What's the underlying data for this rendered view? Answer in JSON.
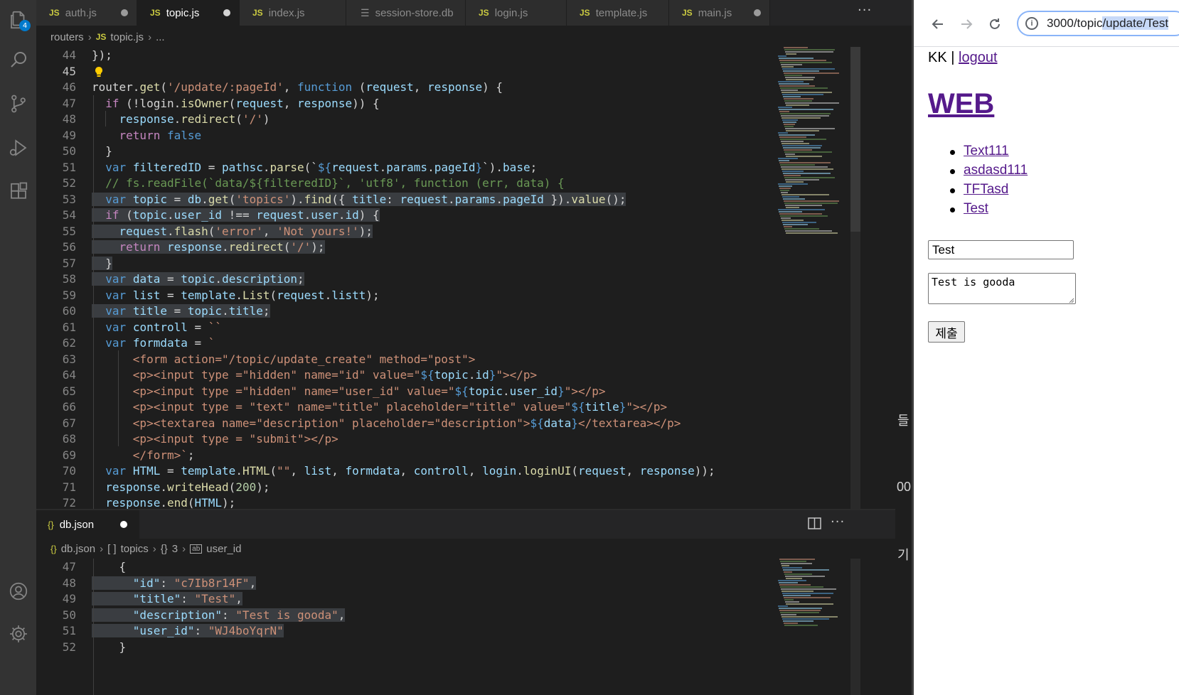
{
  "colors": {
    "accent": "#007acc",
    "editor_bg": "#1e1e1e",
    "selection": "#264f78",
    "link_visited": "#551a8b"
  },
  "vscode": {
    "explorer_badge": "4",
    "tabs": [
      {
        "label": "auth.js",
        "icon": "js-icon",
        "dirty": true
      },
      {
        "label": "topic.js",
        "icon": "js-icon",
        "dirty": true,
        "active": true
      },
      {
        "label": "index.js",
        "icon": "js-icon",
        "dirty": false
      },
      {
        "label": "session-store.db",
        "icon": "file-lines-icon",
        "dirty": false
      },
      {
        "label": "login.js",
        "icon": "js-icon",
        "dirty": false
      },
      {
        "label": "template.js",
        "icon": "js-icon",
        "dirty": false
      },
      {
        "label": "main.js",
        "icon": "js-icon",
        "dirty": true
      }
    ],
    "more_actions": "···",
    "breadcrumb": {
      "folder": "routers",
      "file": "topic.js",
      "tail": "..."
    },
    "editor_lines": [
      {
        "n": "44",
        "tokens": [
          [
            "p",
            "});"
          ]
        ]
      },
      {
        "n": "45",
        "tokens": [
          [
            "p",
            ""
          ]
        ],
        "lightbulb": true
      },
      {
        "n": "46",
        "tokens": [
          [
            "p",
            "router."
          ],
          [
            "f",
            "get"
          ],
          [
            "p",
            "("
          ],
          [
            "s",
            "'/update/:pageId'"
          ],
          [
            "p",
            ", "
          ],
          [
            "k",
            "function"
          ],
          [
            "p",
            " ("
          ],
          [
            "v",
            "request"
          ],
          [
            "p",
            ", "
          ],
          [
            "v",
            "response"
          ],
          [
            "p",
            ") {"
          ]
        ]
      },
      {
        "n": "47",
        "tokens": [
          [
            "p",
            "  "
          ],
          [
            "cf",
            "if"
          ],
          [
            "p",
            " (!login."
          ],
          [
            "f",
            "isOwner"
          ],
          [
            "p",
            "("
          ],
          [
            "v",
            "request"
          ],
          [
            "p",
            ", "
          ],
          [
            "v",
            "response"
          ],
          [
            "p",
            ")) {"
          ]
        ]
      },
      {
        "n": "48",
        "tokens": [
          [
            "p",
            "    "
          ],
          [
            "v",
            "response"
          ],
          [
            "p",
            "."
          ],
          [
            "f",
            "redirect"
          ],
          [
            "p",
            "("
          ],
          [
            "s",
            "'/'"
          ],
          [
            "p",
            ")"
          ]
        ]
      },
      {
        "n": "49",
        "tokens": [
          [
            "p",
            "    "
          ],
          [
            "cf",
            "return"
          ],
          [
            "p",
            " "
          ],
          [
            "k",
            "false"
          ]
        ]
      },
      {
        "n": "50",
        "tokens": [
          [
            "p",
            "  }"
          ]
        ]
      },
      {
        "n": "51",
        "tokens": [
          [
            "p",
            "  "
          ],
          [
            "k",
            "var"
          ],
          [
            "p",
            " "
          ],
          [
            "v",
            "filteredID"
          ],
          [
            "p",
            " = "
          ],
          [
            "v",
            "pathsc"
          ],
          [
            "p",
            "."
          ],
          [
            "f",
            "parse"
          ],
          [
            "p",
            "(`"
          ],
          [
            "tp",
            "${"
          ],
          [
            "v",
            "request"
          ],
          [
            "p",
            "."
          ],
          [
            "v",
            "params"
          ],
          [
            "p",
            "."
          ],
          [
            "v",
            "pageId"
          ],
          [
            "tp",
            "}"
          ],
          [
            "p",
            "`)."
          ],
          [
            "v",
            "base"
          ],
          [
            "p",
            ";"
          ]
        ]
      },
      {
        "n": "52",
        "tokens": [
          [
            "p",
            "  "
          ],
          [
            "c",
            "// fs.readFile(`data/${filteredID}`, 'utf8', function (err, data) {"
          ]
        ]
      },
      {
        "n": "53",
        "hl": true,
        "tokens": [
          [
            "p",
            "  "
          ],
          [
            "k",
            "var"
          ],
          [
            "p",
            " "
          ],
          [
            "v",
            "topic"
          ],
          [
            "p",
            " = "
          ],
          [
            "v",
            "db"
          ],
          [
            "p",
            "."
          ],
          [
            "f",
            "get"
          ],
          [
            "p",
            "("
          ],
          [
            "s",
            "'topics'"
          ],
          [
            "p",
            ")."
          ],
          [
            "f",
            "find"
          ],
          [
            "p",
            "({ "
          ],
          [
            "v",
            "title"
          ],
          [
            "p",
            ": "
          ],
          [
            "v",
            "request"
          ],
          [
            "p",
            "."
          ],
          [
            "v",
            "params"
          ],
          [
            "p",
            "."
          ],
          [
            "v",
            "pageId"
          ],
          [
            "p",
            " })."
          ],
          [
            "f",
            "value"
          ],
          [
            "p",
            "();"
          ]
        ]
      },
      {
        "n": "54",
        "hl": true,
        "tokens": [
          [
            "p",
            "  "
          ],
          [
            "cf",
            "if"
          ],
          [
            "p",
            " ("
          ],
          [
            "v",
            "topic"
          ],
          [
            "p",
            "."
          ],
          [
            "v",
            "user_id"
          ],
          [
            "p",
            " !== "
          ],
          [
            "v",
            "request"
          ],
          [
            "p",
            "."
          ],
          [
            "v",
            "user"
          ],
          [
            "p",
            "."
          ],
          [
            "v",
            "id"
          ],
          [
            "p",
            ") {"
          ]
        ]
      },
      {
        "n": "55",
        "hl": true,
        "tokens": [
          [
            "p",
            "    "
          ],
          [
            "v",
            "request"
          ],
          [
            "p",
            "."
          ],
          [
            "f",
            "flash"
          ],
          [
            "p",
            "("
          ],
          [
            "s",
            "'error'"
          ],
          [
            "p",
            ", "
          ],
          [
            "s",
            "'Not yours!'"
          ],
          [
            "p",
            ");"
          ]
        ]
      },
      {
        "n": "56",
        "hl": true,
        "tokens": [
          [
            "p",
            "    "
          ],
          [
            "cf",
            "return"
          ],
          [
            "p",
            " "
          ],
          [
            "v",
            "response"
          ],
          [
            "p",
            "."
          ],
          [
            "f",
            "redirect"
          ],
          [
            "p",
            "("
          ],
          [
            "s",
            "'/'"
          ],
          [
            "p",
            ");"
          ]
        ]
      },
      {
        "n": "57",
        "hl": true,
        "tokens": [
          [
            "p",
            "  }"
          ]
        ]
      },
      {
        "n": "58",
        "hl": true,
        "tokens": [
          [
            "p",
            "  "
          ],
          [
            "k",
            "var"
          ],
          [
            "p",
            " "
          ],
          [
            "v",
            "data"
          ],
          [
            "p",
            " = "
          ],
          [
            "v",
            "topic"
          ],
          [
            "p",
            "."
          ],
          [
            "v",
            "description"
          ],
          [
            "p",
            ";"
          ]
        ]
      },
      {
        "n": "59",
        "tokens": [
          [
            "p",
            "  "
          ],
          [
            "k",
            "var"
          ],
          [
            "p",
            " "
          ],
          [
            "v",
            "list"
          ],
          [
            "p",
            " = "
          ],
          [
            "v",
            "template"
          ],
          [
            "p",
            "."
          ],
          [
            "f",
            "List"
          ],
          [
            "p",
            "("
          ],
          [
            "v",
            "request"
          ],
          [
            "p",
            "."
          ],
          [
            "v",
            "listt"
          ],
          [
            "p",
            ");"
          ]
        ]
      },
      {
        "n": "60",
        "hl": true,
        "tokens": [
          [
            "p",
            "  "
          ],
          [
            "k",
            "var"
          ],
          [
            "p",
            " "
          ],
          [
            "v",
            "title"
          ],
          [
            "p",
            " = "
          ],
          [
            "v",
            "topic"
          ],
          [
            "p",
            "."
          ],
          [
            "v",
            "title"
          ],
          [
            "p",
            ";"
          ]
        ]
      },
      {
        "n": "61",
        "tokens": [
          [
            "p",
            "  "
          ],
          [
            "k",
            "var"
          ],
          [
            "p",
            " "
          ],
          [
            "v",
            "controll"
          ],
          [
            "p",
            " = "
          ],
          [
            "s",
            "``"
          ]
        ]
      },
      {
        "n": "62",
        "tokens": [
          [
            "p",
            "  "
          ],
          [
            "k",
            "var"
          ],
          [
            "p",
            " "
          ],
          [
            "v",
            "formdata"
          ],
          [
            "p",
            " = "
          ],
          [
            "s",
            "`"
          ]
        ]
      },
      {
        "n": "63",
        "tokens": [
          [
            "s",
            "      <form action=\"/topic/update_create\" method=\"post\">"
          ]
        ]
      },
      {
        "n": "64",
        "tokens": [
          [
            "s",
            "      <p><input type =\"hidden\" name=\"id\" value=\""
          ],
          [
            "tp",
            "${"
          ],
          [
            "v",
            "topic"
          ],
          [
            "p",
            "."
          ],
          [
            "v",
            "id"
          ],
          [
            "tp",
            "}"
          ],
          [
            "s",
            "\"></p>"
          ]
        ]
      },
      {
        "n": "65",
        "tokens": [
          [
            "s",
            "      <p><input type =\"hidden\" name=\"user_id\" value=\""
          ],
          [
            "tp",
            "${"
          ],
          [
            "v",
            "topic"
          ],
          [
            "p",
            "."
          ],
          [
            "v",
            "user_id"
          ],
          [
            "tp",
            "}"
          ],
          [
            "s",
            "\"></p>"
          ]
        ]
      },
      {
        "n": "66",
        "tokens": [
          [
            "s",
            "      <p><input type = \"text\" name=\"title\" placeholder=\"title\" value=\""
          ],
          [
            "tp",
            "${"
          ],
          [
            "v",
            "title"
          ],
          [
            "tp",
            "}"
          ],
          [
            "s",
            "\"></p>"
          ]
        ]
      },
      {
        "n": "67",
        "tokens": [
          [
            "s",
            "      <p><textarea name=\"description\" placeholder=\"description\">"
          ],
          [
            "tp",
            "${"
          ],
          [
            "v",
            "data"
          ],
          [
            "tp",
            "}"
          ],
          [
            "s",
            "</textarea></p>"
          ]
        ]
      },
      {
        "n": "68",
        "tokens": [
          [
            "s",
            "      <p><input type = \"submit\"></p>"
          ]
        ]
      },
      {
        "n": "69",
        "tokens": [
          [
            "s",
            "      </form>`"
          ],
          [
            "p",
            ";"
          ]
        ]
      },
      {
        "n": "70",
        "tokens": [
          [
            "p",
            "  "
          ],
          [
            "k",
            "var"
          ],
          [
            "p",
            " "
          ],
          [
            "v",
            "HTML"
          ],
          [
            "p",
            " = "
          ],
          [
            "v",
            "template"
          ],
          [
            "p",
            "."
          ],
          [
            "f",
            "HTML"
          ],
          [
            "p",
            "("
          ],
          [
            "s",
            "\"\""
          ],
          [
            "p",
            ", "
          ],
          [
            "v",
            "list"
          ],
          [
            "p",
            ", "
          ],
          [
            "v",
            "formdata"
          ],
          [
            "p",
            ", "
          ],
          [
            "v",
            "controll"
          ],
          [
            "p",
            ", "
          ],
          [
            "v",
            "login"
          ],
          [
            "p",
            "."
          ],
          [
            "f",
            "loginUI"
          ],
          [
            "p",
            "("
          ],
          [
            "v",
            "request"
          ],
          [
            "p",
            ", "
          ],
          [
            "v",
            "response"
          ],
          [
            "p",
            "));"
          ]
        ]
      },
      {
        "n": "71",
        "tokens": [
          [
            "p",
            "  "
          ],
          [
            "v",
            "response"
          ],
          [
            "p",
            "."
          ],
          [
            "f",
            "writeHead"
          ],
          [
            "p",
            "("
          ],
          [
            "n",
            "200"
          ],
          [
            "p",
            ");"
          ]
        ]
      },
      {
        "n": "72",
        "tokens": [
          [
            "p",
            "  "
          ],
          [
            "v",
            "response"
          ],
          [
            "p",
            "."
          ],
          [
            "f",
            "end"
          ],
          [
            "p",
            "("
          ],
          [
            "v",
            "HTML"
          ],
          [
            "p",
            ");"
          ]
        ]
      }
    ],
    "panel": {
      "tab_label": "db.json",
      "breadcrumb": {
        "file": "db.json",
        "seg1": "topics",
        "seg2": "3",
        "seg3": "user_id"
      },
      "lines": [
        {
          "n": "47",
          "tokens": [
            [
              "p",
              "    {"
            ]
          ]
        },
        {
          "n": "48",
          "hl": true,
          "tokens": [
            [
              "p",
              "      "
            ],
            [
              "v",
              "\"id\""
            ],
            [
              "p",
              ": "
            ],
            [
              "s",
              "\"c7Ib8r14F\""
            ],
            [
              "p",
              ","
            ]
          ]
        },
        {
          "n": "49",
          "hl": true,
          "tokens": [
            [
              "p",
              "      "
            ],
            [
              "v",
              "\"title\""
            ],
            [
              "p",
              ": "
            ],
            [
              "s",
              "\"Test\""
            ],
            [
              "p",
              ","
            ]
          ]
        },
        {
          "n": "50",
          "hl": true,
          "tokens": [
            [
              "p",
              "      "
            ],
            [
              "v",
              "\"description\""
            ],
            [
              "p",
              ": "
            ],
            [
              "s",
              "\"Test is gooda\""
            ],
            [
              "p",
              ","
            ]
          ]
        },
        {
          "n": "51",
          "hl": true,
          "tokens": [
            [
              "p",
              "      "
            ],
            [
              "v",
              "\"user_id\""
            ],
            [
              "p",
              ": "
            ],
            [
              "s",
              "\"WJ4boYqrN\""
            ]
          ]
        },
        {
          "n": "52",
          "tokens": [
            [
              "p",
              "    }"
            ]
          ]
        }
      ]
    }
  },
  "browser": {
    "url_prefix": "3000/topic",
    "url_selected": "/update/Test",
    "page": {
      "user": "KK",
      "separator": "|",
      "logout_label": "logout",
      "site_title": "WEB",
      "topics": [
        "Text111",
        "asdasd111",
        "TFTasd",
        "Test"
      ],
      "title_value": "Test",
      "description_value": "Test is gooda",
      "submit_label": "제출"
    }
  },
  "peek_glyphs": [
    "들",
    "00",
    "기"
  ]
}
